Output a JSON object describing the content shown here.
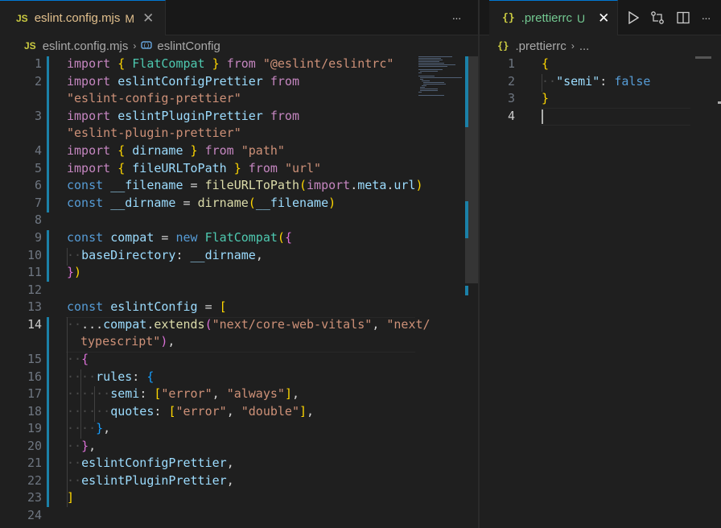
{
  "left_editor": {
    "tab": {
      "icon": "js-icon",
      "icon_text": "JS",
      "title": "eslint.config.mjs",
      "status": "M",
      "close": "✕"
    },
    "more_actions": "···",
    "breadcrumb": {
      "icon_text": "JS",
      "file": "eslint.config.mjs",
      "separator": "›",
      "symbol": "eslintConfig"
    },
    "line_numbers": [
      "1",
      "2",
      "",
      "3",
      "",
      "4",
      "5",
      "6",
      "7",
      "8",
      "9",
      "10",
      "11",
      "12",
      "13",
      "14",
      "",
      "15",
      "16",
      "17",
      "18",
      "19",
      "20",
      "21",
      "22",
      "23",
      "24"
    ],
    "code_lines": [
      "import { FlatCompat } from \"@eslint/eslintrc\"",
      "import eslintConfigPrettier from",
      "\"eslint-config-prettier\"",
      "import eslintPluginPrettier from",
      "\"eslint-plugin-prettier\"",
      "import { dirname } from \"path\"",
      "import { fileURLToPath } from \"url\"",
      "const __filename = fileURLToPath(import.meta.url)",
      "const __dirname = dirname(__filename)",
      "",
      "const compat = new FlatCompat({",
      "  baseDirectory: __dirname,",
      "})",
      "",
      "const eslintConfig = [",
      "  ...compat.extends(\"next/core-web-vitals\", \"next/",
      "typescript\"),",
      "  {",
      "    rules: {",
      "      semi: [\"error\", \"always\"],",
      "      quotes: [\"error\", \"double\"],",
      "    },",
      "  },",
      "  eslintConfigPrettier,",
      "  eslintPluginPrettier,",
      "]",
      ""
    ]
  },
  "right_editor": {
    "tab": {
      "icon": "json-icon",
      "icon_text": "{}",
      "title": ".prettierrc",
      "status": "U",
      "close": "✕"
    },
    "actions": [
      "run-icon",
      "compare-changes-icon",
      "split-editor-icon",
      "more-actions-icon"
    ],
    "more_actions": "···",
    "breadcrumb": {
      "icon_text": "{}",
      "file": ".prettierrc",
      "separator": "›",
      "ellipsis": "..."
    },
    "line_numbers": [
      "1",
      "2",
      "3",
      "4"
    ],
    "code_lines": [
      "{",
      "  \"semi\": false",
      "}",
      ""
    ]
  },
  "colors": {
    "keyword": "#c586c0",
    "storage": "#569cd6",
    "string": "#ce9178",
    "variable": "#9cdcfe",
    "function": "#dcdcaa",
    "class": "#4ec9b0",
    "bracket1": "#ffd700",
    "bracket2": "#da70d6",
    "bracket3": "#179fff",
    "modified_gutter": "#1b81a8",
    "added_gutter": "#487e02"
  }
}
